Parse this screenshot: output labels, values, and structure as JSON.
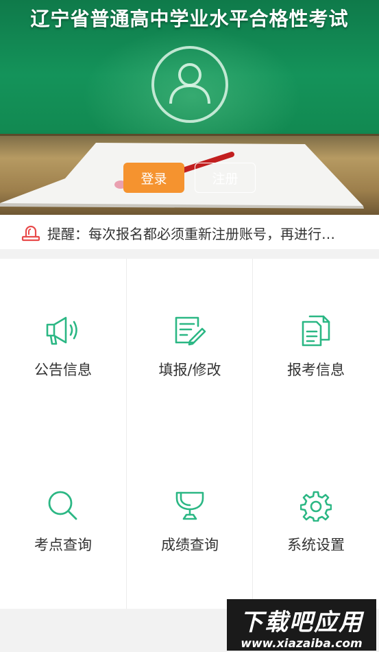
{
  "header": {
    "title": "辽宁省普通高中学业水平合格性考试",
    "login_label": "登录",
    "register_label": "注册"
  },
  "notice": {
    "text": "提醒：每次报名都必须重新注册账号，再进行…"
  },
  "menu": [
    {
      "label": "公告信息",
      "icon": "megaphone-icon"
    },
    {
      "label": "填报/修改",
      "icon": "edit-form-icon"
    },
    {
      "label": "报考信息",
      "icon": "documents-icon"
    },
    {
      "label": "考点查询",
      "icon": "search-icon"
    },
    {
      "label": "成绩查询",
      "icon": "trophy-icon"
    },
    {
      "label": "系统设置",
      "icon": "gear-icon"
    }
  ],
  "watermark": {
    "main": "下载吧应用",
    "url": "www.xiazaiba.com"
  },
  "colors": {
    "accent_green": "#2bb784",
    "login_orange": "#f5932f",
    "alert_red": "#e84a4a"
  }
}
